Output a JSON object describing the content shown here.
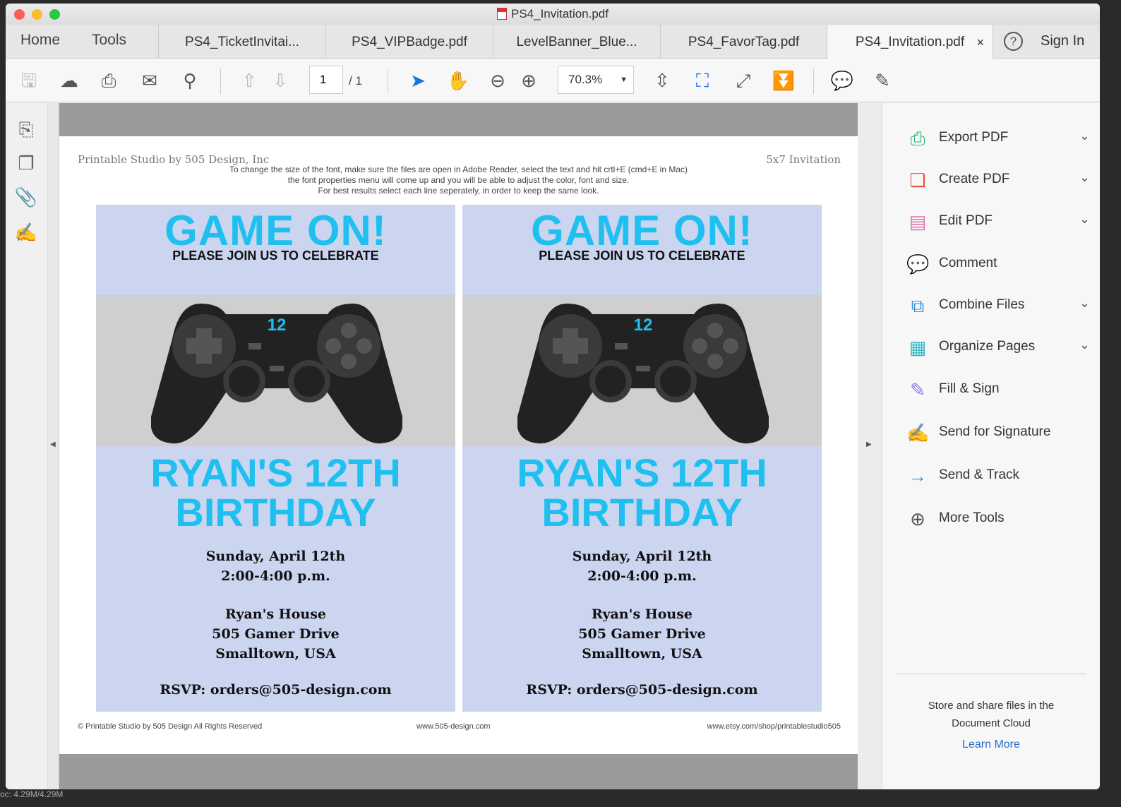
{
  "window": {
    "title": "PS4_Invitation.pdf"
  },
  "nav": {
    "home": "Home",
    "tools": "Tools",
    "help_icon": "?",
    "sign_in": "Sign In"
  },
  "tabs": [
    {
      "label": "PS4_TicketInvitai..."
    },
    {
      "label": "PS4_VIPBadge.pdf"
    },
    {
      "label": "LevelBanner_Blue..."
    },
    {
      "label": "PS4_FavorTag.pdf"
    },
    {
      "label": "PS4_Invitation.pdf",
      "active": true,
      "close": "×"
    }
  ],
  "toolbar": {
    "page_current": "1",
    "page_total": "/ 1",
    "zoom": "70.3%"
  },
  "document": {
    "header_left": "Printable Studio by 505 Design, Inc",
    "header_right": "5x7 Invitation",
    "instructions": [
      "To change the size of the font, make sure the files are open in Adobe Reader, select the text and hit crtl+E (cmd+E in Mac)",
      "the font properties menu will come up and you will be able to adjust the color, font and size.",
      "For best results select each line seperately, in order to keep the same look."
    ],
    "card": {
      "title": "GAME ON!",
      "subtitle": "PLEASE JOIN US TO CELEBRATE",
      "number": "12",
      "name_line1": "RYAN'S 12TH",
      "name_line2": "BIRTHDAY",
      "date": "Sunday, April 12th",
      "time": "2:00-4:00 p.m.",
      "place": "Ryan's House",
      "street": "505 Gamer Drive",
      "city": "Smalltown, USA",
      "rsvp": "RSVP: orders@505-design.com"
    },
    "footer_left": "© Printable Studio by 505 Design All Rights Reserved",
    "footer_center": "www.505-design.com",
    "footer_right": "www.etsy.com/shop/printablestudio505"
  },
  "right_panel": {
    "items": [
      {
        "label": "Export PDF",
        "icon": "export-pdf-icon",
        "color": "#2bb673",
        "chevron": true
      },
      {
        "label": "Create PDF",
        "icon": "create-pdf-icon",
        "color": "#e9564b",
        "chevron": true
      },
      {
        "label": "Edit PDF",
        "icon": "edit-pdf-icon",
        "color": "#e76fa6",
        "chevron": true
      },
      {
        "label": "Comment",
        "icon": "comment-icon",
        "color": "#f5b335",
        "chevron": false
      },
      {
        "label": "Combine Files",
        "icon": "combine-files-icon",
        "color": "#3a8fd8",
        "chevron": true
      },
      {
        "label": "Organize Pages",
        "icon": "organize-pages-icon",
        "color": "#37b6c9",
        "chevron": true
      },
      {
        "label": "Fill & Sign",
        "icon": "fill-sign-icon",
        "color": "#8f7ae6",
        "chevron": false
      },
      {
        "label": "Send for Signature",
        "icon": "send-signature-icon",
        "color": "#8f7ae6",
        "chevron": false
      },
      {
        "label": "Send & Track",
        "icon": "send-track-icon",
        "color": "#3a8fd8",
        "chevron": false
      },
      {
        "label": "More Tools",
        "icon": "more-tools-icon",
        "color": "#555555",
        "chevron": false
      }
    ],
    "cloud_text": "Store and share files in the Document Cloud",
    "learn_more": "Learn More"
  },
  "status": {
    "memory": "oc: 4.29M/4.29M"
  }
}
